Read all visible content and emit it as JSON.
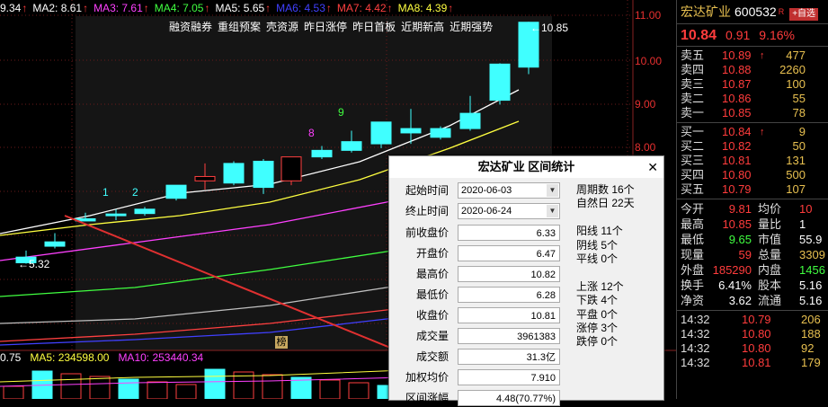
{
  "ma_legend": [
    {
      "label": "9.34",
      "color": "#ffffff"
    },
    {
      "label": "MA2: 8.61",
      "color": "#ffffff"
    },
    {
      "label": "MA3: 7.61",
      "color": "#ff40ff"
    },
    {
      "label": "MA4: 7.05",
      "color": "#40ff40"
    },
    {
      "label": "MA5: 5.65",
      "color": "#ffffff"
    },
    {
      "label": "MA6: 4.53",
      "color": "#4040ff"
    },
    {
      "label": "MA7: 4.42",
      "color": "#ff4040"
    },
    {
      "label": "MA8: 4.39",
      "color": "#ffff40"
    }
  ],
  "tags": [
    "融资融券",
    "重组预案",
    "壳资源",
    "昨日涨停",
    "昨日首板",
    "近期新高",
    "近期强势"
  ],
  "price_axis": [
    "11.00",
    "10.00",
    "9.00",
    "8.00"
  ],
  "high_label": "10.85",
  "low_label": "5.32",
  "bang_label": "榜",
  "seq_labels": [
    {
      "text": "1",
      "color": "#40ffff"
    },
    {
      "text": "2",
      "color": "#40ffff"
    },
    {
      "text": "8",
      "color": "#ff40ff"
    },
    {
      "text": "9",
      "color": "#40ff40"
    }
  ],
  "volume_legend": [
    {
      "label": "0.75",
      "color": "#ffffff"
    },
    {
      "label": "MA5: 234598.00",
      "color": "#ffff40"
    },
    {
      "label": "MA10: 253440.34",
      "color": "#ff40ff"
    }
  ],
  "stock": {
    "name": "宏达矿业",
    "code": "600532",
    "badge": "R",
    "add_label": "+自选",
    "price": "10.84",
    "change": "0.91",
    "pct": "9.16%"
  },
  "order_book": {
    "asks": [
      {
        "label": "卖五",
        "price": "10.89",
        "vol": "477",
        "arrow": "↑"
      },
      {
        "label": "卖四",
        "price": "10.88",
        "vol": "2260",
        "arrow": ""
      },
      {
        "label": "卖三",
        "price": "10.87",
        "vol": "100",
        "arrow": ""
      },
      {
        "label": "卖二",
        "price": "10.86",
        "vol": "55",
        "arrow": ""
      },
      {
        "label": "卖一",
        "price": "10.85",
        "vol": "78",
        "arrow": ""
      }
    ],
    "bids": [
      {
        "label": "买一",
        "price": "10.84",
        "vol": "9",
        "arrow": "↑"
      },
      {
        "label": "买二",
        "price": "10.82",
        "vol": "50",
        "arrow": ""
      },
      {
        "label": "买三",
        "price": "10.81",
        "vol": "131",
        "arrow": ""
      },
      {
        "label": "买四",
        "price": "10.80",
        "vol": "500",
        "arrow": ""
      },
      {
        "label": "买五",
        "price": "10.79",
        "vol": "107",
        "arrow": ""
      }
    ]
  },
  "quote_stats": [
    {
      "l1": "今开",
      "v1": "9.81",
      "c1": "#ff3c3c",
      "l2": "均价",
      "v2": "10",
      "c2": "#ff3c3c"
    },
    {
      "l1": "最高",
      "v1": "10.85",
      "c1": "#ff3c3c",
      "l2": "量比",
      "v2": "1",
      "c2": "#ffffff"
    },
    {
      "l1": "最低",
      "v1": "9.65",
      "c1": "#40ff40",
      "l2": "市值",
      "v2": "55.9",
      "c2": "#ffffff"
    },
    {
      "l1": "现量",
      "v1": "59",
      "c1": "#ff3c3c",
      "l2": "总量",
      "v2": "3309",
      "c2": "#e8c050"
    },
    {
      "l1": "外盘",
      "v1": "185290",
      "c1": "#ff3c3c",
      "l2": "内盘",
      "v2": "1456",
      "c2": "#40ff40"
    },
    {
      "l1": "换手",
      "v1": "6.41%",
      "c1": "#ffffff",
      "l2": "股本",
      "v2": "5.16",
      "c2": "#ffffff"
    },
    {
      "l1": "净资",
      "v1": "3.62",
      "c1": "#ffffff",
      "l2": "流通",
      "v2": "5.16",
      "c2": "#ffffff"
    }
  ],
  "ticks": [
    {
      "time": "14:32",
      "price": "10.79",
      "vol": "206"
    },
    {
      "time": "14:32",
      "price": "10.80",
      "vol": "188"
    },
    {
      "time": "14:32",
      "price": "10.80",
      "vol": "92"
    },
    {
      "time": "14:32",
      "price": "10.81",
      "vol": "179"
    }
  ],
  "dialog": {
    "title": "宏达矿业 区间统计",
    "close": "✕",
    "start_label": "起始时间",
    "start": "2020-06-03",
    "end_label": "终止时间",
    "end": "2020-06-24",
    "fields": [
      {
        "label": "前收盘价",
        "value": "6.33"
      },
      {
        "label": "开盘价",
        "value": "6.47"
      },
      {
        "label": "最高价",
        "value": "10.82"
      },
      {
        "label": "最低价",
        "value": "6.28"
      },
      {
        "label": "收盘价",
        "value": "10.81"
      },
      {
        "label": "成交量",
        "value": "3961383"
      },
      {
        "label": "成交额",
        "value": "31.3亿"
      },
      {
        "label": "加权均价",
        "value": "7.910"
      },
      {
        "label": "区间涨幅",
        "value": "4.48(70.77%)"
      }
    ],
    "right": [
      "周期数 16个",
      "自然日 22天",
      "",
      "阳线 11个",
      "阴线 5个",
      "平线 0个",
      "",
      "上涨 12个",
      "下跌 4个",
      "平盘 0个",
      "涨停 3个",
      "跌停 0个"
    ]
  }
}
